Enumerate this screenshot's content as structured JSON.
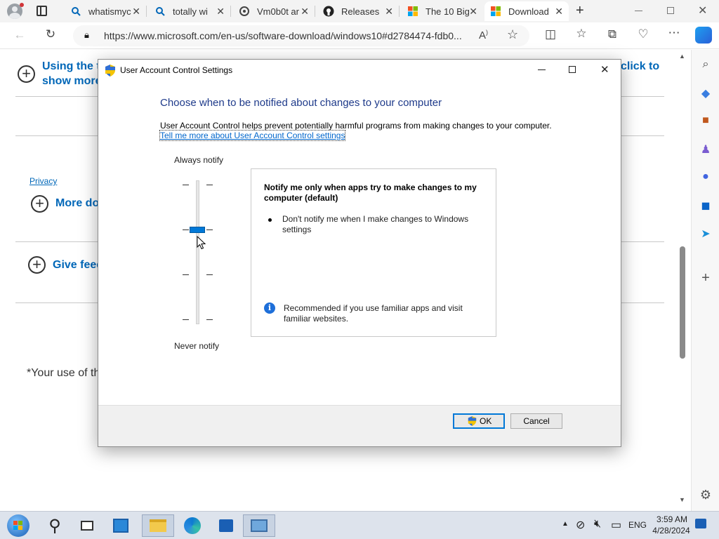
{
  "browser": {
    "tabs": [
      {
        "title": "whatismyc",
        "icon": "search-icon"
      },
      {
        "title": "totally wi",
        "icon": "search-icon"
      },
      {
        "title": "Vm0b0t ar",
        "icon": "vm-icon"
      },
      {
        "title": "Releases",
        "icon": "github-icon"
      },
      {
        "title": "The 10 Big",
        "icon": "microsoft-icon"
      },
      {
        "title": "Download",
        "icon": "microsoft-icon"
      }
    ],
    "url": "https://www.microsoft.com/en-us/software-download/windows10#d2784474-fdb0..."
  },
  "page": {
    "item1": "Using the t",
    "item1_more": "show more",
    "right_link": "click to",
    "privacy": "Privacy",
    "more": "More do",
    "feedback": "Give feed",
    "footer": "*Your use of th"
  },
  "dialog": {
    "title": "User Account Control Settings",
    "heading": "Choose when to be notified about changes to your computer",
    "intro": "User Account Control helps prevent potentially harmful programs from making changes to your computer.",
    "link": "Tell me more about User Account Control settings",
    "always": "Always notify",
    "never": "Never notify",
    "slider_level": 2,
    "slider_levels": 4,
    "desc_title": "Notify me only when apps try to make changes to my computer (default)",
    "desc_bullet": "Don't notify me when I make changes to Windows settings",
    "recommend": "Recommended if you use familiar apps and visit familiar websites.",
    "ok": "OK",
    "cancel": "Cancel"
  },
  "taskbar": {
    "lang": "ENG",
    "time": "3:59 AM",
    "date": "4/28/2024"
  },
  "colors": {
    "accent": "#0067b8",
    "slider_thumb": "#0078d7"
  }
}
